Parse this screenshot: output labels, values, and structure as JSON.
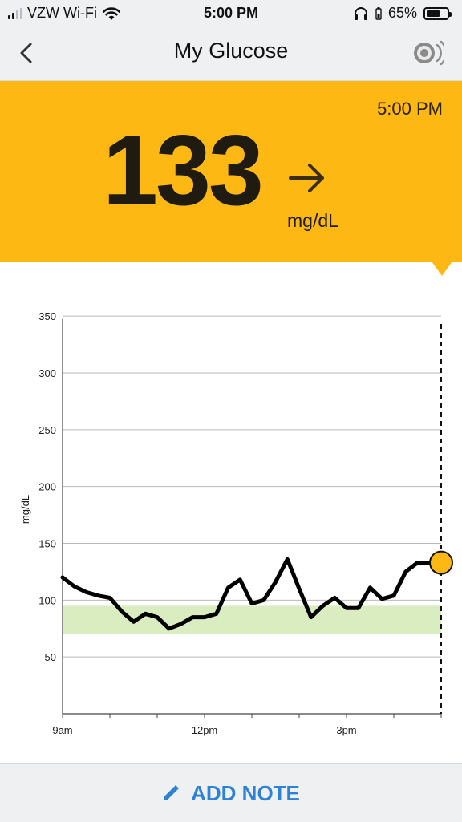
{
  "status_bar": {
    "carrier": "VZW Wi-Fi",
    "time": "5:00 PM",
    "battery": "65%",
    "battery_level": 0.65
  },
  "header": {
    "title": "My Glucose",
    "back_icon": "chevron-left-icon",
    "sound_icon": "sensor-sound-icon"
  },
  "reading": {
    "time": "5:00 PM",
    "value": "133",
    "unit": "mg/dL",
    "trend": "steady-right-arrow",
    "banner_color": "#fdb813"
  },
  "chart_data": {
    "type": "line",
    "ylabel": "mg/dL",
    "ylim": [
      0,
      360
    ],
    "yticks": [
      50,
      100,
      150,
      200,
      250,
      300,
      350
    ],
    "xlim": [
      9,
      17
    ],
    "xticks": [
      {
        "value": 9,
        "label": "9am"
      },
      {
        "value": 12,
        "label": "12pm"
      },
      {
        "value": 15,
        "label": "3pm"
      }
    ],
    "target_range": [
      70,
      95
    ],
    "current_time": 17,
    "current_value": 133,
    "series": [
      {
        "points": [
          [
            9.0,
            120
          ],
          [
            9.25,
            112
          ],
          [
            9.5,
            107
          ],
          [
            9.75,
            104
          ],
          [
            10.0,
            102
          ],
          [
            10.25,
            90
          ],
          [
            10.5,
            81
          ],
          [
            10.75,
            88
          ],
          [
            11.0,
            85
          ],
          [
            11.25,
            75
          ],
          [
            11.5,
            79
          ],
          [
            11.75,
            85
          ],
          [
            12.0,
            85
          ],
          [
            12.25,
            88
          ],
          [
            12.5,
            111
          ],
          [
            12.75,
            118
          ],
          [
            13.0,
            97
          ],
          [
            13.25,
            100
          ],
          [
            13.5,
            116
          ],
          [
            13.75,
            136
          ],
          [
            14.0,
            110
          ],
          [
            14.25,
            85
          ],
          [
            14.5,
            95
          ],
          [
            14.75,
            102
          ],
          [
            15.0,
            93
          ],
          [
            15.25,
            93
          ],
          [
            15.5,
            111
          ],
          [
            15.75,
            101
          ],
          [
            16.0,
            104
          ],
          [
            16.25,
            125
          ],
          [
            16.5,
            133
          ],
          [
            16.75,
            133
          ],
          [
            17.0,
            133
          ]
        ]
      }
    ],
    "colors": {
      "line": "#000000",
      "target_band": "#d9edc1",
      "marker": "#fdb813",
      "grid": "#b9b9b9"
    }
  },
  "bottom_bar": {
    "add_note_label": "ADD NOTE",
    "pencil_icon": "pencil-icon",
    "accent": "#2e82d6"
  }
}
